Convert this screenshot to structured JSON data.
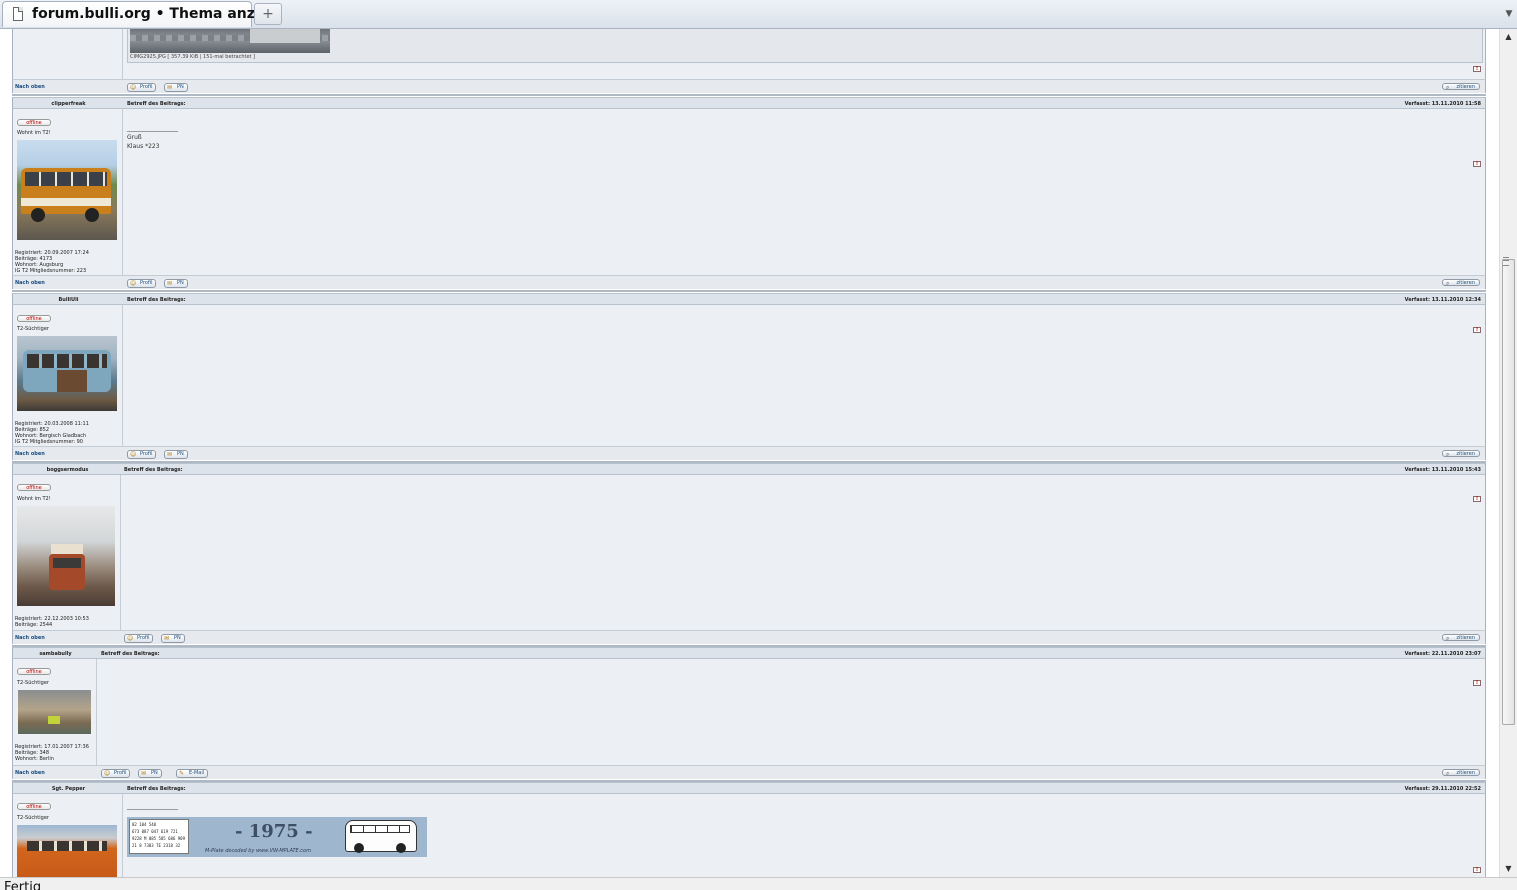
{
  "browser": {
    "tab_title": "forum.bulli.org • Thema anze...",
    "new_tab_symbol": "+",
    "status_text": "Fertig"
  },
  "top_attachment": {
    "caption": "CIMG2925.JPG [ 357.39 KiB | 151-mal betrachtet ]"
  },
  "labels": {
    "nav_top": "Nach oben",
    "profile": "Profil",
    "pm": "PN",
    "email": "E-Mail",
    "quote": "zitieren",
    "offline": "offline",
    "subject": "Betreff des Beitrags:",
    "posted": "Verfasst:"
  },
  "posts": [
    {
      "username": "clipperfreak",
      "rank": "Wohnt im T2!",
      "date": "13.11.2010 11:58",
      "content_lines": [
        "_________________",
        "Gruß",
        "Klaus *223"
      ],
      "stats": [
        "Registriert: 20.09.2007 17:24",
        "Beiträge: 4173",
        "Wohnort: Augsburg",
        "IG T2 Mitgliedsnummer: 223"
      ],
      "has_email": false
    },
    {
      "username": "BulliUli",
      "rank": "T2-Süchtiger",
      "date": "13.11.2010 12:34",
      "content_lines": [],
      "stats": [
        "Registriert: 20.03.2008 11:11",
        "Beiträge: 852",
        "Wohnort: Bergisch Gladbach",
        "IG T2 Mitgliedsnummer: 90"
      ],
      "has_email": false
    },
    {
      "username": "boggsermodus",
      "rank": "Wohnt im T2!",
      "date": "13.11.2010 15:43",
      "content_lines": [],
      "stats": [
        "Registriert: 22.12.2003 10:53",
        "Beiträge: 2544"
      ],
      "has_email": false
    },
    {
      "username": "sambabully",
      "rank": "T2-Süchtiger",
      "date": "22.11.2010 23:07",
      "content_lines": [],
      "stats": [
        "Registriert: 17.01.2007 17:36",
        "Beiträge: 348",
        "Wohnort: Berlin"
      ],
      "has_email": true
    },
    {
      "username": "Sgt. Pepper",
      "rank": "T2-Süchtiger",
      "date": "29.11.2010 22:52",
      "content_lines": [
        "_________________"
      ],
      "stats": [],
      "has_email": false
    }
  ],
  "signature_banner": {
    "year": "- 1975 -",
    "footer": "M-Plate decoded by www.VW-MPLATE.com",
    "codes_line1": "02 104 540",
    "codes_line2": "673 087 047 619 721",
    "codes_line3": "9228 M   085 585 686 909",
    "codes_line4": "21 8 7303   TE   2318 32"
  },
  "colors": {
    "header_bg": "#dde3ea",
    "post_bg": "#eceff3",
    "link": "#1a4c7e"
  }
}
